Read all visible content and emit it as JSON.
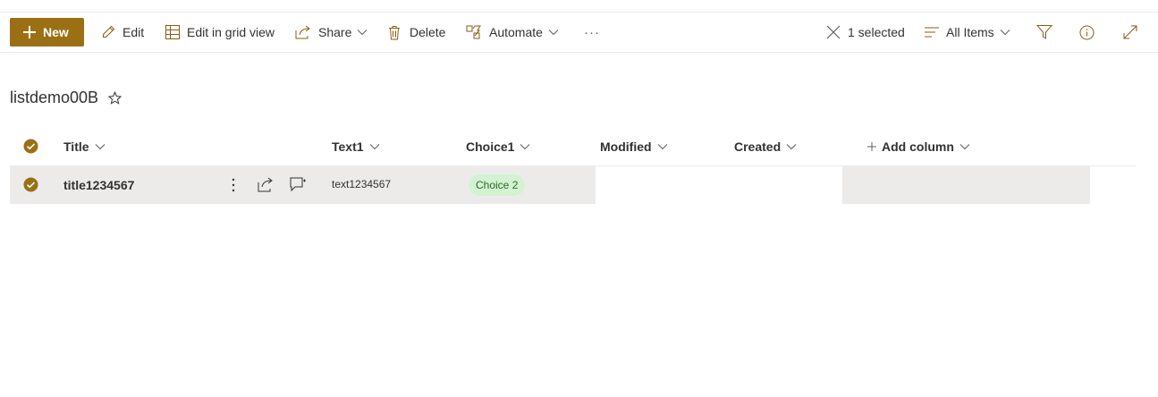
{
  "commandbar": {
    "new_label": "New",
    "edit_label": "Edit",
    "grid_label": "Edit in grid view",
    "share_label": "Share",
    "delete_label": "Delete",
    "automate_label": "Automate",
    "more_label": "···",
    "selected_label": "1 selected",
    "view_label": "All Items"
  },
  "list": {
    "title": "listdemo00B"
  },
  "columns": {
    "title": "Title",
    "text1": "Text1",
    "choice1": "Choice1",
    "modified": "Modified",
    "created": "Created",
    "add": "Add column"
  },
  "rows": [
    {
      "title": "title1234567",
      "text1": "text1234567",
      "choice1": "Choice 2",
      "modified": "",
      "created": "",
      "selected": true
    }
  ],
  "colors": {
    "accent": "#9b7015",
    "row_selected": "#edebe9",
    "pill_bg": "#d3f2d2",
    "pill_text": "#2a6a2a"
  }
}
